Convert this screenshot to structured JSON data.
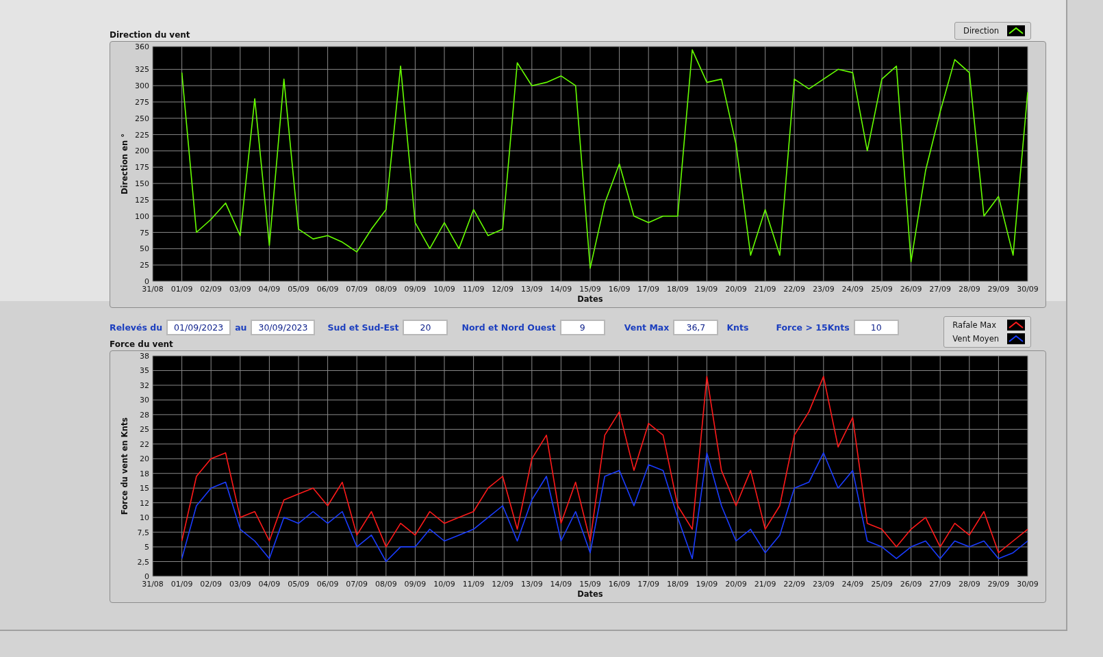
{
  "charts": [
    {
      "title": "Direction du vent",
      "chart_data": {
        "type": "line",
        "grid": true,
        "xlabel": "Dates",
        "ylabel": "Direction en °",
        "ylim": [
          0,
          360
        ],
        "yticks": [
          0,
          25,
          50,
          75,
          100,
          125,
          150,
          175,
          200,
          225,
          250,
          275,
          300,
          325,
          360
        ],
        "categories": [
          "31/08",
          null,
          "01/09",
          null,
          "02/09",
          null,
          "03/09",
          null,
          "04/09",
          null,
          "05/09",
          null,
          "06/09",
          null,
          "07/09",
          null,
          "08/09",
          null,
          "09/09",
          null,
          "10/09",
          null,
          "11/09",
          null,
          "12/09",
          null,
          "13/09",
          null,
          "14/09",
          null,
          "15/09",
          null,
          "16/09",
          null,
          "17/09",
          null,
          "18/09",
          null,
          "19/09",
          null,
          "20/09",
          null,
          "21/09",
          null,
          "22/09",
          null,
          "23/09",
          null,
          "24/09",
          null,
          "25/09",
          null,
          "26/09",
          null,
          "27/09",
          null,
          "28/09",
          null,
          "29/09",
          null,
          "30/09"
        ],
        "series": [
          {
            "name": "Direction",
            "color": "#66ff00",
            "values": [
              null,
              null,
              320,
              75,
              95,
              120,
              70,
              280,
              55,
              310,
              80,
              65,
              70,
              60,
              45,
              80,
              110,
              330,
              90,
              50,
              90,
              50,
              110,
              70,
              80,
              335,
              300,
              305,
              315,
              300,
              20,
              120,
              180,
              100,
              90,
              100,
              100,
              355,
              305,
              310,
              210,
              40,
              110,
              40,
              310,
              295,
              310,
              325,
              320,
              200,
              310,
              330,
              30,
              170,
              260,
              340,
              320,
              100,
              130,
              40,
              290
            ]
          }
        ]
      }
    },
    {
      "title": "Force du vent",
      "chart_data": {
        "type": "line",
        "grid": true,
        "xlabel": "Dates",
        "ylabel": "Force du vent en Knts",
        "ylim": [
          0,
          37.5
        ],
        "yticks": [
          0,
          {
            "value": 2.5,
            "label": "2,5"
          },
          5,
          {
            "value": 7.5,
            "label": "7,5"
          },
          {
            "value": 10,
            "label": "10"
          },
          {
            "value": 12.5,
            "label": "12"
          },
          15,
          {
            "value": 17.5,
            "label": "18"
          },
          {
            "value": 20,
            "label": "20"
          },
          {
            "value": 22.5,
            "label": "22"
          },
          25,
          {
            "value": 27.5,
            "label": "28"
          },
          30,
          {
            "value": 32.5,
            "label": "32"
          },
          35,
          {
            "value": 37.5,
            "label": "38"
          }
        ],
        "categories": [
          "31/08",
          null,
          "01/09",
          null,
          "02/09",
          null,
          "03/09",
          null,
          "04/09",
          null,
          "05/09",
          null,
          "06/09",
          null,
          "07/09",
          null,
          "08/09",
          null,
          "09/09",
          null,
          "10/09",
          null,
          "11/09",
          null,
          "12/09",
          null,
          "13/09",
          null,
          "14/09",
          null,
          "15/09",
          null,
          "16/09",
          null,
          "17/09",
          null,
          "18/09",
          null,
          "19/09",
          null,
          "20/09",
          null,
          "21/09",
          null,
          "22/09",
          null,
          "23/09",
          null,
          "24/09",
          null,
          "25/09",
          null,
          "26/09",
          null,
          "27/09",
          null,
          "28/09",
          null,
          "29/09",
          null,
          "30/09"
        ],
        "series": [
          {
            "name": "Rafale Max",
            "color": "#ff1a1a",
            "values": [
              null,
              null,
              6,
              17,
              20,
              21,
              10,
              11,
              6,
              13,
              14,
              15,
              12,
              16,
              7,
              11,
              5,
              9,
              7,
              11,
              9,
              10,
              11,
              15,
              17,
              8,
              20,
              24,
              9,
              16,
              6,
              24,
              28,
              18,
              26,
              24,
              12,
              8,
              34,
              18,
              12,
              18,
              8,
              12,
              24,
              28,
              34,
              22,
              27,
              9,
              8,
              5,
              8,
              10,
              5,
              9,
              7,
              11,
              4,
              6,
              8
            ]
          },
          {
            "name": "Vent Moyen",
            "color": "#1a3cff",
            "values": [
              null,
              null,
              3,
              12,
              15,
              16,
              8,
              6,
              3,
              10,
              9,
              11,
              9,
              11,
              5,
              7,
              2.5,
              5,
              5,
              8,
              6,
              7,
              8,
              10,
              12,
              6,
              13,
              17,
              6,
              11,
              4,
              17,
              18,
              12,
              19,
              18,
              10,
              3,
              21,
              12,
              6,
              8,
              4,
              7,
              15,
              16,
              21,
              15,
              18,
              6,
              5,
              3,
              5,
              6,
              3,
              6,
              5,
              6,
              3,
              4,
              6
            ]
          }
        ]
      }
    }
  ],
  "controls": [
    {
      "label": "Relevés du",
      "value": "01/09/2023"
    },
    {
      "label": "au",
      "value": "30/09/2023"
    },
    {
      "label": "Sud et Sud-Est",
      "value": "20"
    },
    {
      "label": "Nord et Nord Ouest",
      "value": "9"
    },
    {
      "label": "Vent Max",
      "value": "36,7",
      "unit": "Knts"
    },
    {
      "label": "Force > 15Knts",
      "value": "10"
    }
  ]
}
